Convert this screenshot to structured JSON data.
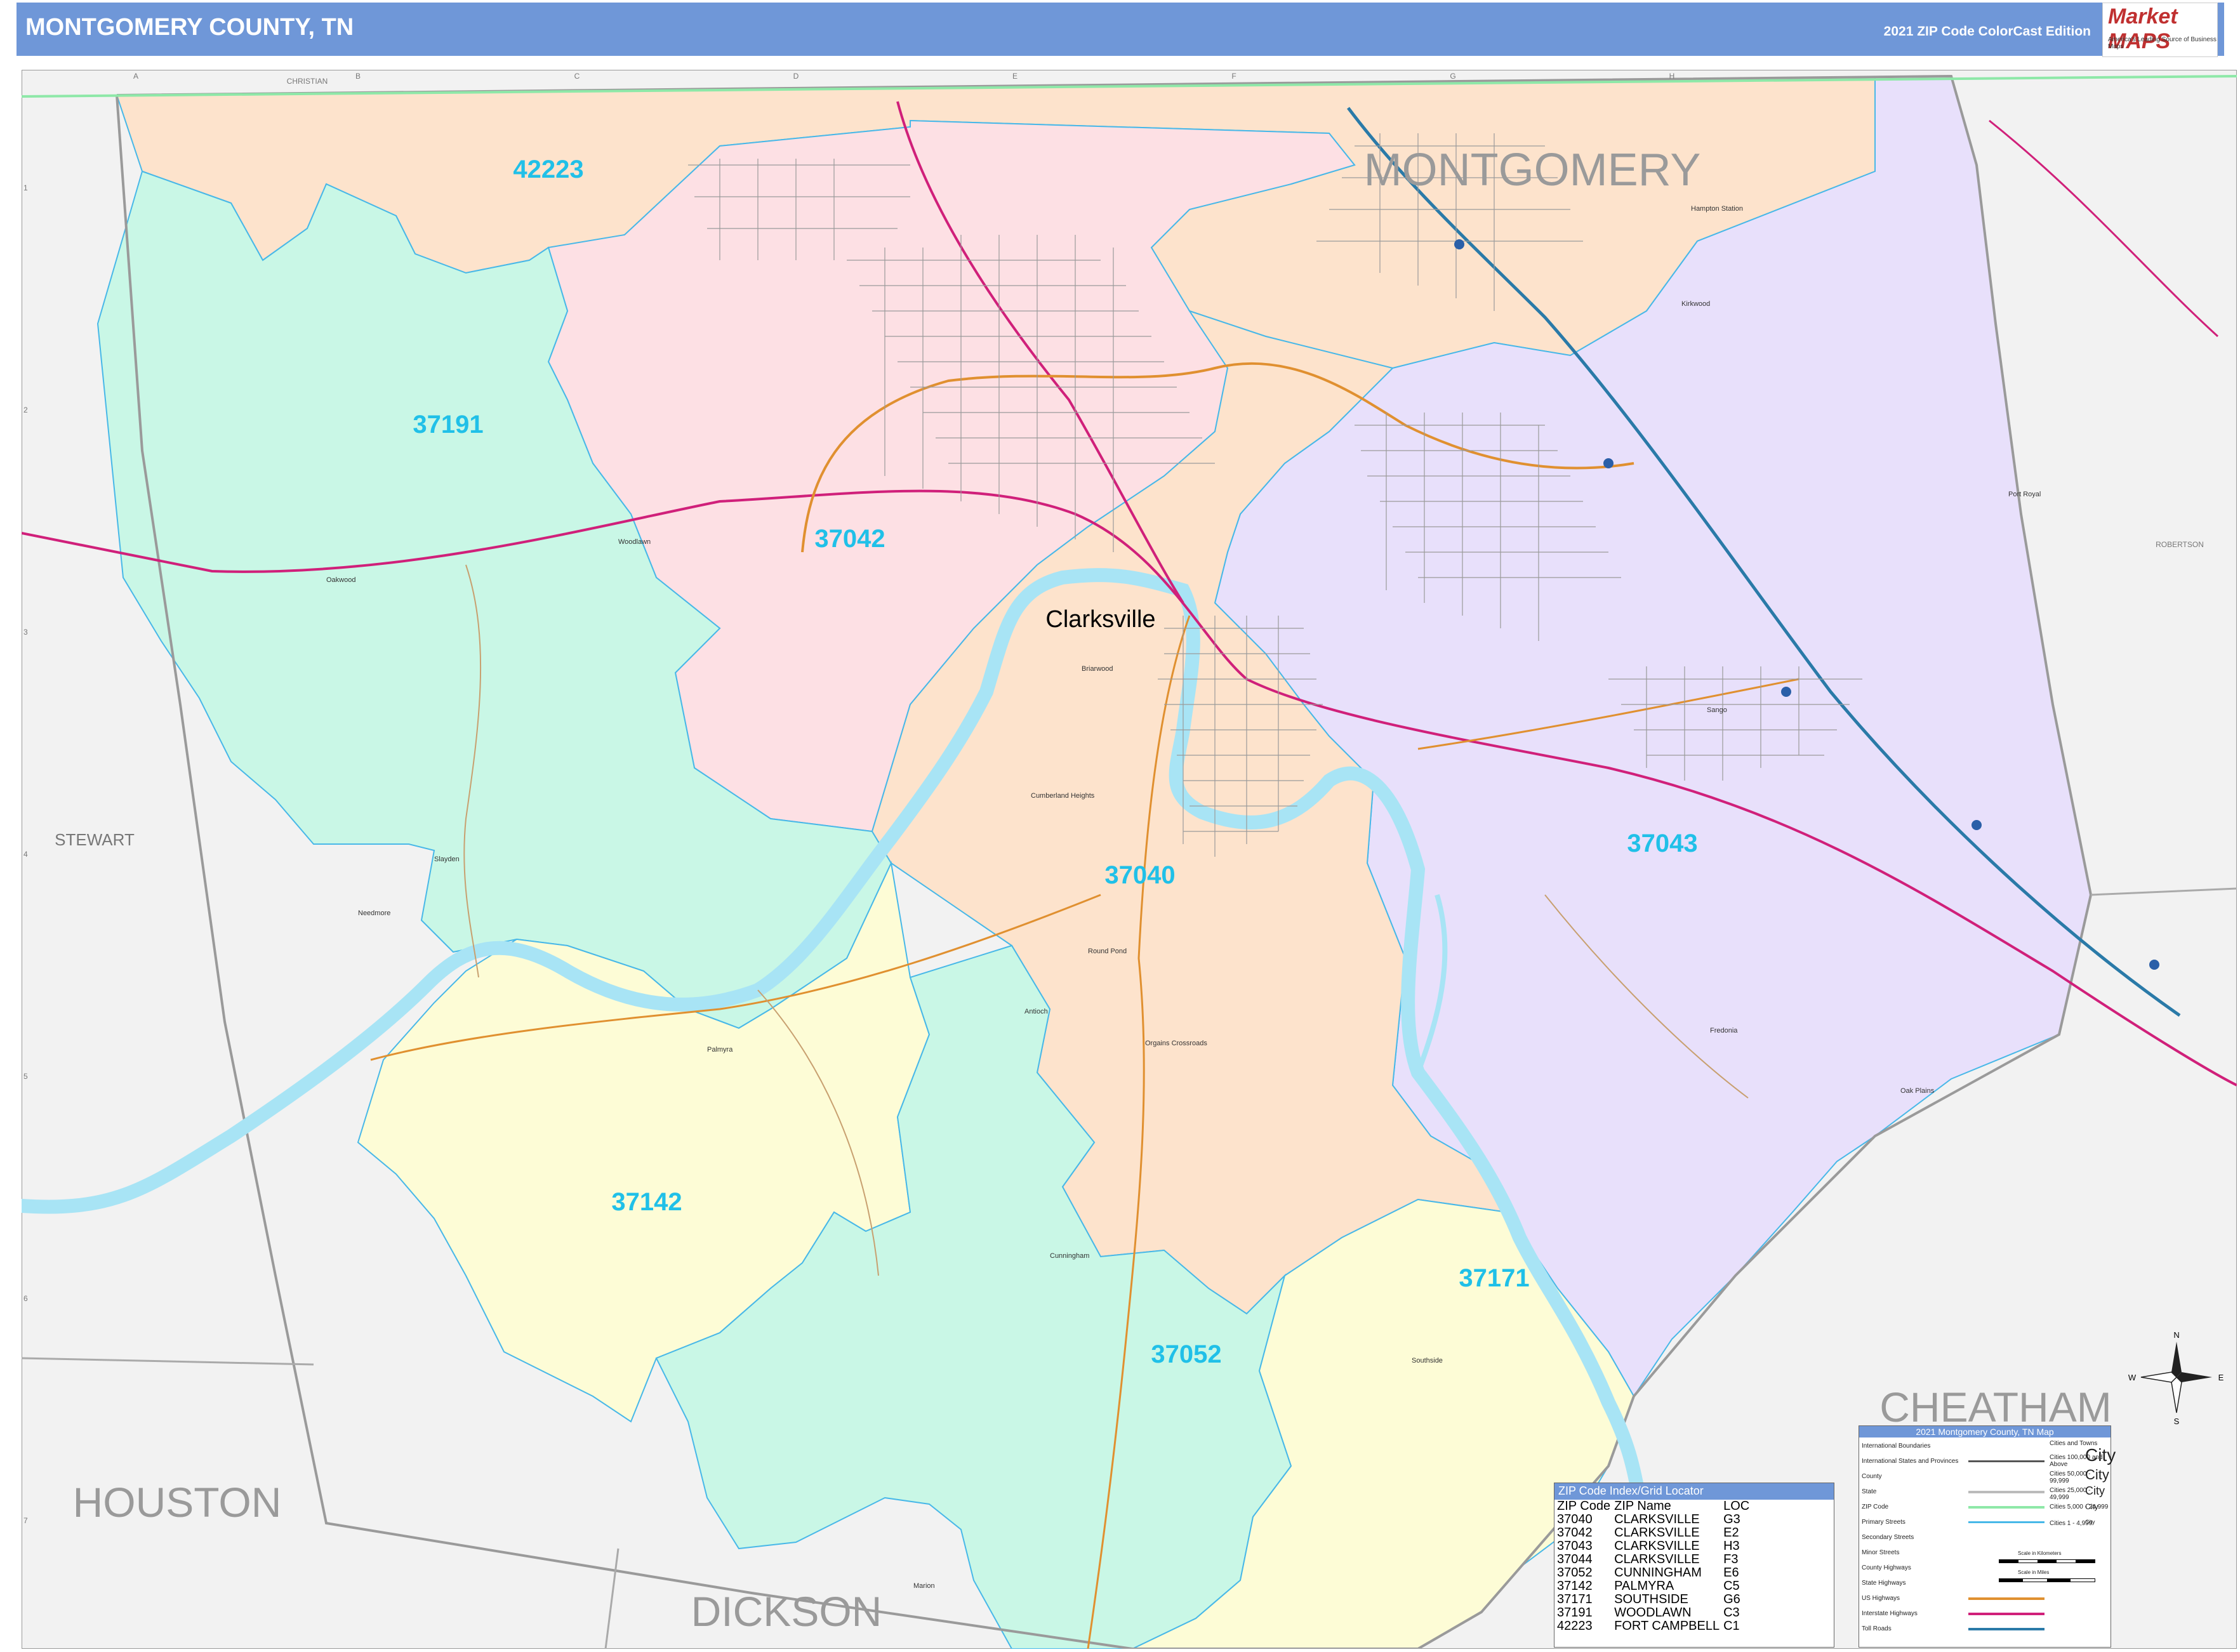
{
  "header": {
    "title": "MONTGOMERY COUNTY, TN",
    "edition": "2021 ZIP Code ColorCast Edition",
    "logo_text": "Market MAPS",
    "logo_tagline": "On Target. On Time.",
    "logo_subtagline": "America's Leading Source of Business Maps"
  },
  "grid": {
    "columns": [
      "A",
      "B",
      "C",
      "D",
      "E",
      "F",
      "G",
      "H"
    ],
    "rows": [
      "1",
      "2",
      "3",
      "4",
      "5",
      "6",
      "7"
    ]
  },
  "counties": {
    "montgomery": "MONTGOMERY",
    "houston": "HOUSTON",
    "dickson": "DICKSON",
    "cheatham": "CHEATHAM",
    "stewart": "STEWART",
    "christian": "CHRISTIAN",
    "robertson": "ROBERTSON"
  },
  "zip_labels": {
    "z42223": "42223",
    "z37191": "37191",
    "z37042": "37042",
    "z37040": "37040",
    "z37043": "37043",
    "z37142": "37142",
    "z37171": "37171",
    "z37052": "37052"
  },
  "main_city": "Clarksville",
  "places": {
    "woodlawn": "Woodlawn",
    "oakwood": "Oakwood",
    "slayden": "Slayden",
    "needmore": "Needmore",
    "palmyra": "Palmyra",
    "cunningham": "Cunningham",
    "southside": "Southside",
    "fredonia": "Fredonia",
    "oak_plains": "Oak Plains",
    "sango": "Sango",
    "hampton_station": "Hampton Station",
    "kirkwood": "Kirkwood",
    "port_royal": "Port Royal",
    "briarwood": "Briarwood",
    "cumberland_heights": "Cumberland Heights",
    "round_pond": "Round Pond",
    "antioch": "Antioch",
    "orgains_crossroads": "Orgains Crossroads",
    "marion": "Marion"
  },
  "colors": {
    "header": "#6f97d8",
    "z42223": "#fde3cc",
    "z37040": "#fde3cc",
    "z37191": "#c9f7e6",
    "z37052": "#c9f7e6",
    "z37042": "#fde0e4",
    "z37043": "#e8e0fb",
    "z37142": "#fdfcd6",
    "z37171": "#fdfcd6",
    "zip_label": "#20c0e8",
    "zip_boundary": "#48b8e8",
    "water": "#a8e4f5",
    "outside": "#f2f2f2",
    "county_line": "#999999",
    "interstate": "#2a7aa8",
    "us_highway": "#d0207a",
    "state_highway": "#e09030"
  },
  "zip_index": {
    "title": "ZIP Code Index/Grid Locator",
    "headers": [
      "ZIP Code",
      "ZIP Name",
      "LOC"
    ],
    "rows": [
      [
        "37040",
        "CLARKSVILLE",
        "G3"
      ],
      [
        "37042",
        "CLARKSVILLE",
        "E2"
      ],
      [
        "37043",
        "CLARKSVILLE",
        "H3"
      ],
      [
        "37044",
        "CLARKSVILLE",
        "F3"
      ],
      [
        "37052",
        "CUNNINGHAM",
        "E6"
      ],
      [
        "37142",
        "PALMYRA",
        "C5"
      ],
      [
        "37171",
        "SOUTHSIDE",
        "G6"
      ],
      [
        "37191",
        "WOODLAWN",
        "C3"
      ],
      [
        "42223",
        "FORT CAMPBELL",
        "C1"
      ]
    ]
  },
  "map_legend": {
    "title": "2021 Montgomery County, TN Map",
    "items": [
      "International Boundaries",
      "International States and Provinces",
      "County",
      "State",
      "ZIP Code",
      "Primary Streets",
      "Secondary Streets",
      "Minor Streets",
      "County Highways",
      "State Highways",
      "US Highways",
      "Interstate Highways",
      "Toll Roads"
    ],
    "city_sizes": [
      "Cities and Towns",
      "Cities 100,000 and Above",
      "Cities 50,000 - 99,999",
      "Cities 25,000 - 49,999",
      "Cities 5,000 - 24,999",
      "Cities 1 - 4,999"
    ],
    "city_samples": [
      "City",
      "City",
      "City",
      "City",
      "City"
    ],
    "scale_km": "Scale in Kilometers",
    "scale_mi": "Scale in Miles"
  },
  "compass": {
    "n": "N",
    "s": "S",
    "e": "E",
    "w": "W"
  }
}
